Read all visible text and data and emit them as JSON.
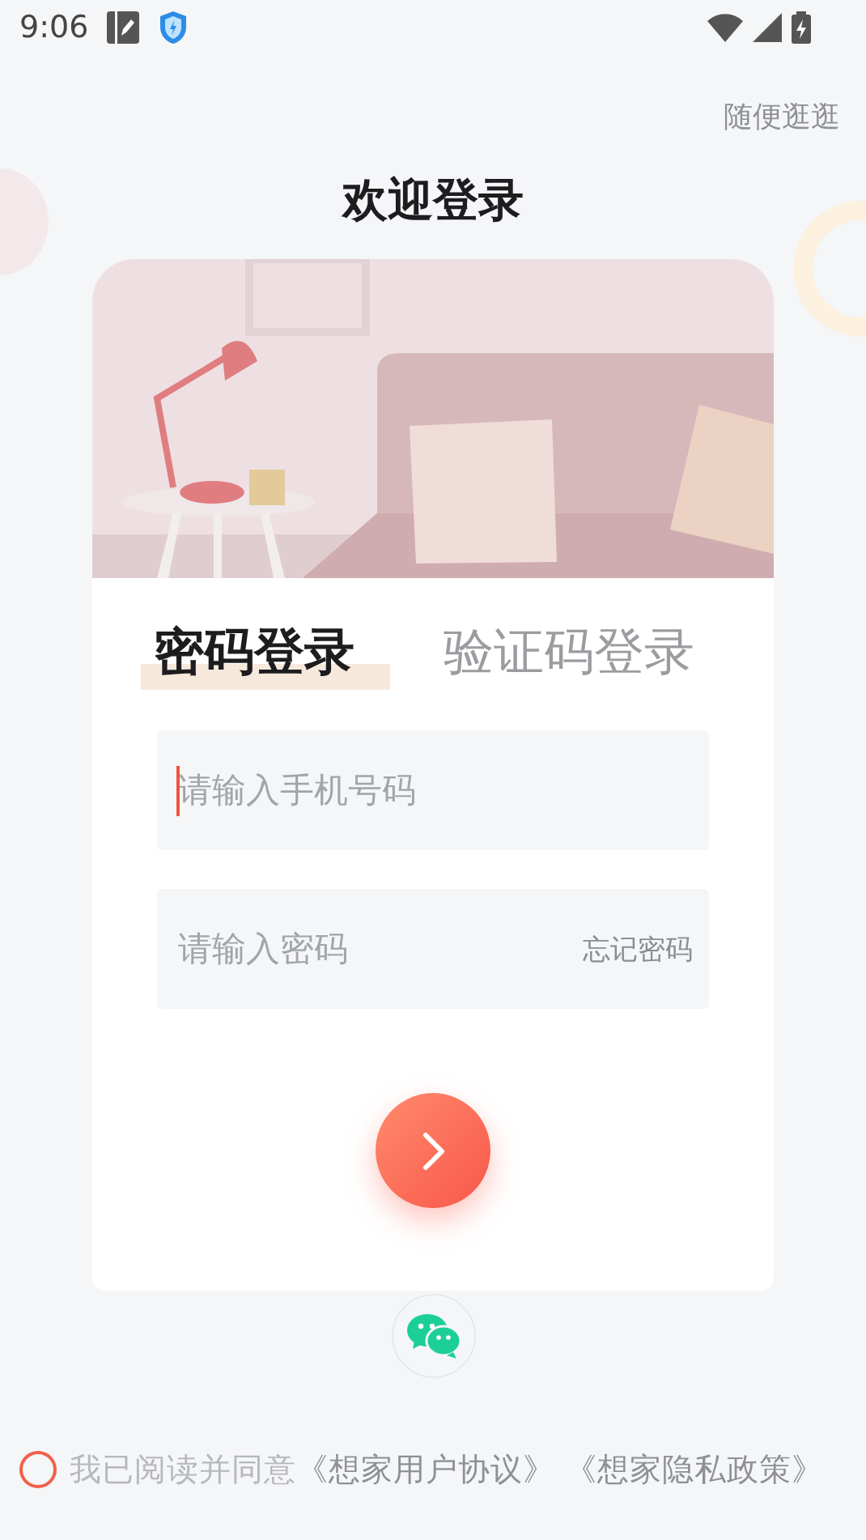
{
  "status_bar": {
    "time": "9:06"
  },
  "skip_link": "随便逛逛",
  "title": "欢迎登录",
  "tabs": [
    {
      "label": "密码登录",
      "selected": true
    },
    {
      "label": "验证码登录",
      "selected": false
    }
  ],
  "fields": [
    {
      "placeholder": "请输入手机号码",
      "focused": true
    },
    {
      "placeholder": "请输入密码",
      "focused": false,
      "action": "忘记密码"
    }
  ],
  "agreement": {
    "checked": false,
    "text": "我已阅读并同意",
    "links": [
      "《想家用户协议》",
      "《想家隐私政策》"
    ]
  }
}
